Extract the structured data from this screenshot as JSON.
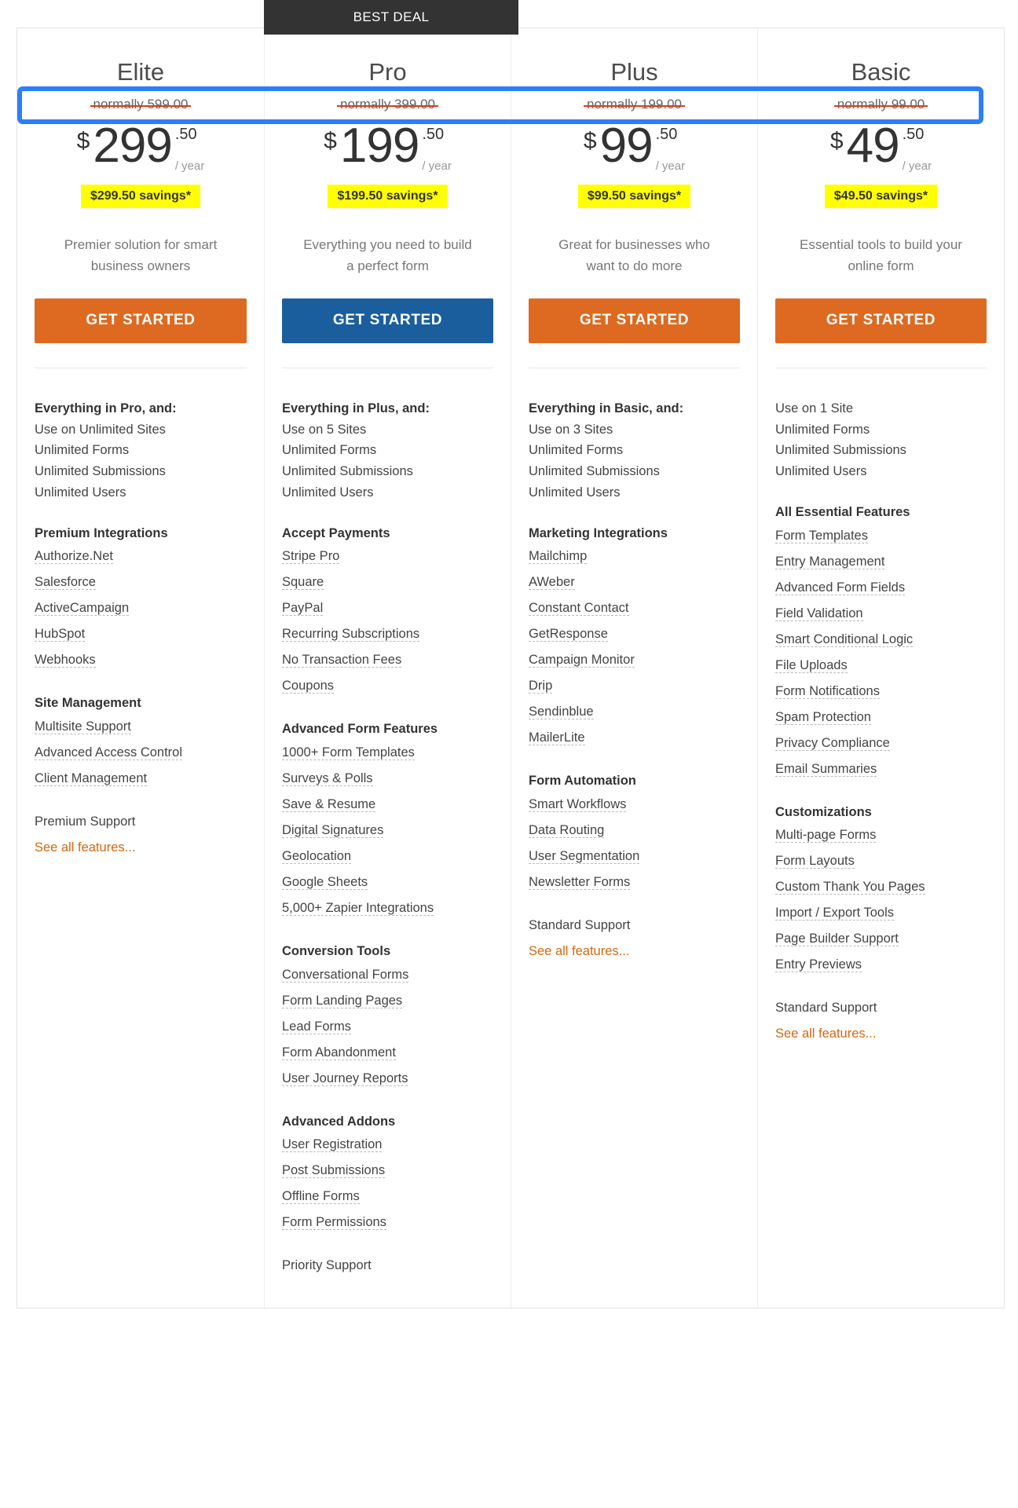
{
  "ribbon": {
    "label": "BEST DEAL"
  },
  "currency_symbol": "$",
  "cents_suffix": ".50",
  "period": "/ year",
  "plans": [
    {
      "name": "Elite",
      "normally": "normally 599.00",
      "amount": "299",
      "cents": ".50",
      "period": "/ year",
      "savings": "$299.50 savings*",
      "tagline": "Premier solution for smart business owners",
      "cta_label": "GET STARTED",
      "cta_style": "orange",
      "featured": false,
      "groups": [
        {
          "title": "Everything in Pro, and:",
          "plain": [
            "Use on Unlimited Sites",
            "Unlimited Forms",
            "Unlimited Submissions",
            "Unlimited Users"
          ],
          "tips": []
        },
        {
          "title": "Premium Integrations",
          "plain": [],
          "tips": [
            "Authorize.Net",
            "Salesforce",
            "ActiveCampaign",
            "HubSpot",
            "Webhooks"
          ]
        },
        {
          "title": "Site Management",
          "plain": [],
          "tips": [
            "Multisite Support",
            "Advanced Access Control",
            "Client Management"
          ]
        }
      ],
      "support": "Premium Support",
      "see_all": "See all features..."
    },
    {
      "name": "Pro",
      "normally": "normally 399.00",
      "amount": "199",
      "cents": ".50",
      "period": "/ year",
      "savings": "$199.50 savings*",
      "tagline": "Everything you need to build a perfect form",
      "cta_label": "GET STARTED",
      "cta_style": "blue",
      "featured": true,
      "groups": [
        {
          "title": "Everything in Plus, and:",
          "plain": [
            "Use on 5 Sites",
            "Unlimited Forms",
            "Unlimited Submissions",
            "Unlimited Users"
          ],
          "tips": []
        },
        {
          "title": "Accept Payments",
          "plain": [],
          "tips": [
            "Stripe Pro",
            "Square",
            "PayPal",
            "Recurring Subscriptions",
            "No Transaction Fees",
            "Coupons"
          ]
        },
        {
          "title": "Advanced Form Features",
          "plain": [],
          "tips": [
            "1000+ Form Templates",
            "Surveys & Polls",
            "Save & Resume",
            "Digital Signatures",
            "Geolocation",
            "Google Sheets",
            "5,000+ Zapier Integrations"
          ]
        },
        {
          "title": "Conversion Tools",
          "plain": [],
          "tips": [
            "Conversational Forms",
            "Form Landing Pages",
            "Lead Forms",
            "Form Abandonment",
            "User Journey Reports"
          ]
        },
        {
          "title": "Advanced Addons",
          "plain": [],
          "tips": [
            "User Registration",
            "Post Submissions",
            "Offline Forms",
            "Form Permissions"
          ]
        }
      ],
      "support": "Priority Support",
      "see_all": ""
    },
    {
      "name": "Plus",
      "normally": "normally 199.00",
      "amount": "99",
      "cents": ".50",
      "period": "/ year",
      "savings": "$99.50 savings*",
      "tagline": "Great for businesses who want to do more",
      "cta_label": "GET STARTED",
      "cta_style": "orange",
      "featured": false,
      "groups": [
        {
          "title": "Everything in Basic, and:",
          "plain": [
            "Use on 3 Sites",
            "Unlimited Forms",
            "Unlimited Submissions",
            "Unlimited Users"
          ],
          "tips": []
        },
        {
          "title": "Marketing Integrations",
          "plain": [],
          "tips": [
            "Mailchimp",
            "AWeber",
            "Constant Contact",
            "GetResponse",
            "Campaign Monitor",
            "Drip",
            "Sendinblue",
            "MailerLite"
          ]
        },
        {
          "title": "Form Automation",
          "plain": [],
          "tips": [
            "Smart Workflows",
            "Data Routing",
            "User Segmentation",
            "Newsletter Forms"
          ]
        }
      ],
      "support": "Standard Support",
      "see_all": "See all features..."
    },
    {
      "name": "Basic",
      "normally": "normally 99.00",
      "amount": "49",
      "cents": ".50",
      "period": "/ year",
      "savings": "$49.50 savings*",
      "tagline": "Essential tools to build your online form",
      "cta_label": "GET STARTED",
      "cta_style": "orange",
      "featured": false,
      "groups": [
        {
          "title": "",
          "plain": [
            "Use on 1 Site",
            "Unlimited Forms",
            "Unlimited Submissions",
            "Unlimited Users"
          ],
          "tips": []
        },
        {
          "title": "All Essential Features",
          "plain": [],
          "tips": [
            "Form Templates",
            "Entry Management",
            "Advanced Form Fields",
            "Field Validation",
            "Smart Conditional Logic",
            "File Uploads",
            "Form Notifications",
            "Spam Protection",
            "Privacy Compliance",
            "Email Summaries"
          ]
        },
        {
          "title": "Customizations",
          "plain": [],
          "tips": [
            "Multi-page Forms",
            "Form Layouts",
            "Custom Thank You Pages",
            "Import / Export Tools",
            "Page Builder Support",
            "Entry Previews"
          ]
        }
      ],
      "support": "Standard Support",
      "see_all": "See all features..."
    }
  ],
  "colors": {
    "orange_cta": "#dd6a20",
    "blue_cta": "#1b5e9e",
    "ribbon_bg": "#333333",
    "savings_bg": "#ffff00",
    "strike": "#e03a1e",
    "link": "#d1690f",
    "highlight": "#2d7ff9"
  }
}
